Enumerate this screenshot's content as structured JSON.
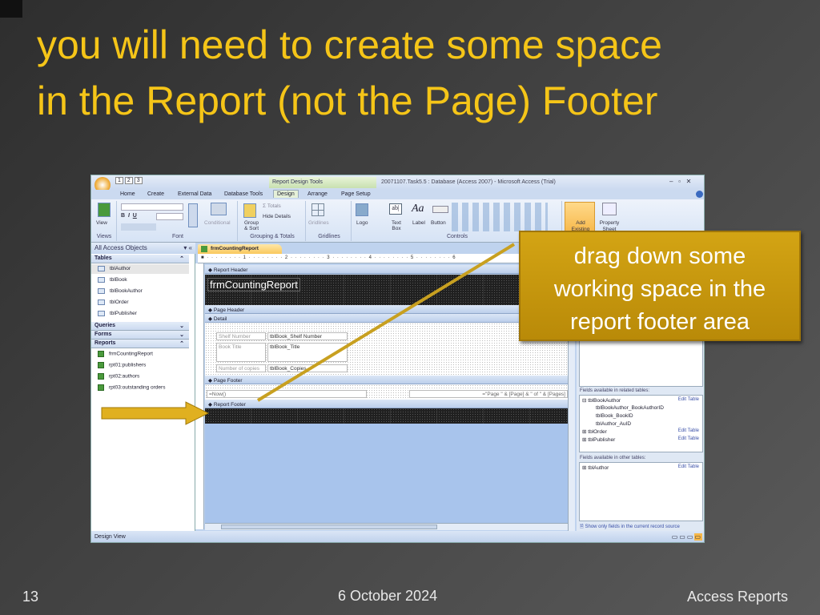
{
  "slide": {
    "title_line1": "you will need to create some space",
    "title_line2": "in the Report (not the Page) Footer",
    "slide_number": "13",
    "date": "6 October 2024",
    "footer_title": "Access Reports",
    "callout_lines": [
      "drag down some",
      "working space in the",
      "report footer area"
    ],
    "colors": {
      "title": "#f5c518",
      "callout": "#c89a10",
      "arrow": "#c8a020"
    }
  },
  "access": {
    "window_title": "20071107.Task5.5 : Database (Access 2007) - Microsoft Access (Trial)",
    "context_tab": "Report Design Tools",
    "qat_keys": [
      "1",
      "2",
      "3"
    ],
    "tabs": [
      {
        "label": "Home",
        "key": "H"
      },
      {
        "label": "Create",
        "key": "C"
      },
      {
        "label": "External Data",
        "key": "X"
      },
      {
        "label": "Database Tools",
        "key": "A"
      },
      {
        "label": "Design",
        "key": "M",
        "active": true
      },
      {
        "label": "Arrange",
        "key": "N"
      },
      {
        "label": "Page Setup",
        "key": "S"
      }
    ],
    "ribbon": {
      "view": "View",
      "conditional": "Conditional",
      "group_sort": "Group & Sort",
      "totals": "Σ Totals",
      "hide_details": "Hide Details",
      "gridlines": "Gridlines",
      "logo": "Logo",
      "text_box": "Text Box",
      "label": "Label",
      "button": "Button",
      "add_existing_fields": "Add Existing Fields",
      "property_sheet": "Property Sheet",
      "groups": [
        "Views",
        "Font",
        "Grouping & Totals",
        "Gridlines",
        "Controls"
      ]
    },
    "nav": {
      "header": "All Access Objects",
      "categories": {
        "tables": "Tables",
        "queries": "Queries",
        "forms": "Forms",
        "reports": "Reports"
      },
      "tables": [
        "tblAuthor",
        "tblBook",
        "tblBookAuthor",
        "tblOrder",
        "tblPublisher"
      ],
      "reports": [
        "frmCountingReport",
        "rpt01:publishers",
        "rpt02:authors",
        "rpt03:outstanding orders"
      ]
    },
    "document_tab": "frmCountingReport",
    "ruler": "■ · · · · · · · · 1 · · · · · · · · 2 · · · · · · · · 3 · · · · · · · · 4 · · · · · · · · 5 · · · · · · · · 6",
    "sections": {
      "report_header": "Report Header",
      "report_title": "frmCountingReport",
      "page_header": "Page Header",
      "detail": "Detail",
      "page_footer": "Page Footer",
      "report_footer": "Report Footer"
    },
    "detail_fields": [
      {
        "label": "Shelf Number",
        "field": "tblBook_Shelf Number"
      },
      {
        "label": "Book Title",
        "field": "tblBook_Title"
      },
      {
        "label": "Number of copies",
        "field": "tblBook_Copies"
      }
    ],
    "page_footer_fields": {
      "left": "=Now()",
      "right": "=\"Page \" & [Page] & \" of \" & [Pages]"
    },
    "field_list": {
      "related_label": "Fields available in related tables:",
      "related": [
        {
          "name": "tblBookAuthor",
          "expanded": true,
          "fields": [
            "tblBookAuthor_BookAuthorID",
            "tblBook_BookID",
            "tblAuthor_AuID"
          ]
        },
        {
          "name": "tblOrder",
          "expanded": false
        },
        {
          "name": "tblPublisher",
          "expanded": false
        }
      ],
      "other_label": "Fields available in other tables:",
      "other": [
        {
          "name": "tblAuthor",
          "expanded": false
        }
      ],
      "edit_table": "Edit Table",
      "show_only": "Show only fields in the current record source"
    },
    "status": "Design View"
  }
}
